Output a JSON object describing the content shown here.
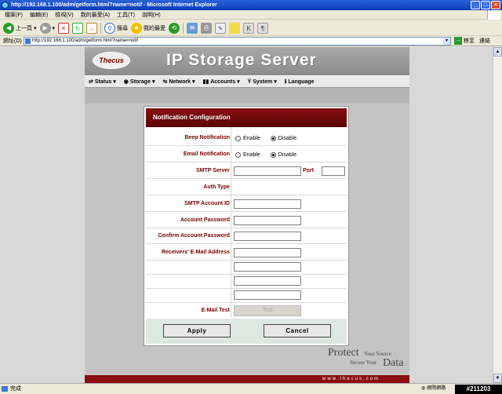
{
  "window": {
    "title": "http://192.168.1.100/adm/getform.html?name=notif - Microsoft Internet Explorer"
  },
  "menubar": {
    "items": [
      "檔案(F)",
      "編輯(E)",
      "檢視(V)",
      "我的最愛(A)",
      "工具(T)",
      "說明(H)"
    ]
  },
  "toolbar": {
    "back_label": "上一頁",
    "search_label": "搜尋",
    "favorites_label": "我的最愛"
  },
  "addressbar": {
    "label": "網址(D)",
    "url": "http://192.168.1.100/adm/getform.html?name=notif",
    "go_label": "移至",
    "links_label": "連結"
  },
  "site": {
    "logo": "Thecus",
    "brand": "IP Storage Server",
    "nav": [
      "Status",
      "Storage",
      "Network",
      "Accounts",
      "System",
      "Language"
    ],
    "footer_url": "www.thecus.com",
    "slogan": {
      "word1": "Protect",
      "line1": "Your Source",
      "line2": "Secure Your",
      "word2": "Data"
    }
  },
  "form": {
    "title": "Notification Configuration",
    "beep_label": "Beep Notification",
    "email_label": "Email Notification",
    "enable": "Enable",
    "disable": "Disable",
    "beep_selected": "Disable",
    "email_selected": "Disable",
    "smtp_label": "SMTP Server",
    "port_label": "Port",
    "auth_label": "Auth Type",
    "account_id_label": "SMTP Account ID",
    "password_label": "Account Password",
    "confirm_label": "Confirm Account Password",
    "receivers_label": "Receivers' E-Mail Address",
    "test_label": "E-Mail Test",
    "test_button": "Test",
    "apply_button": "Apply",
    "cancel_button": "Cancel"
  },
  "statusbar": {
    "text": "完成",
    "zone": "網際網路",
    "watermark": "#211203"
  },
  "colors": {
    "accent": "#8a0d10",
    "label": "#7a0000",
    "titlebar": "#0a3ab8"
  }
}
